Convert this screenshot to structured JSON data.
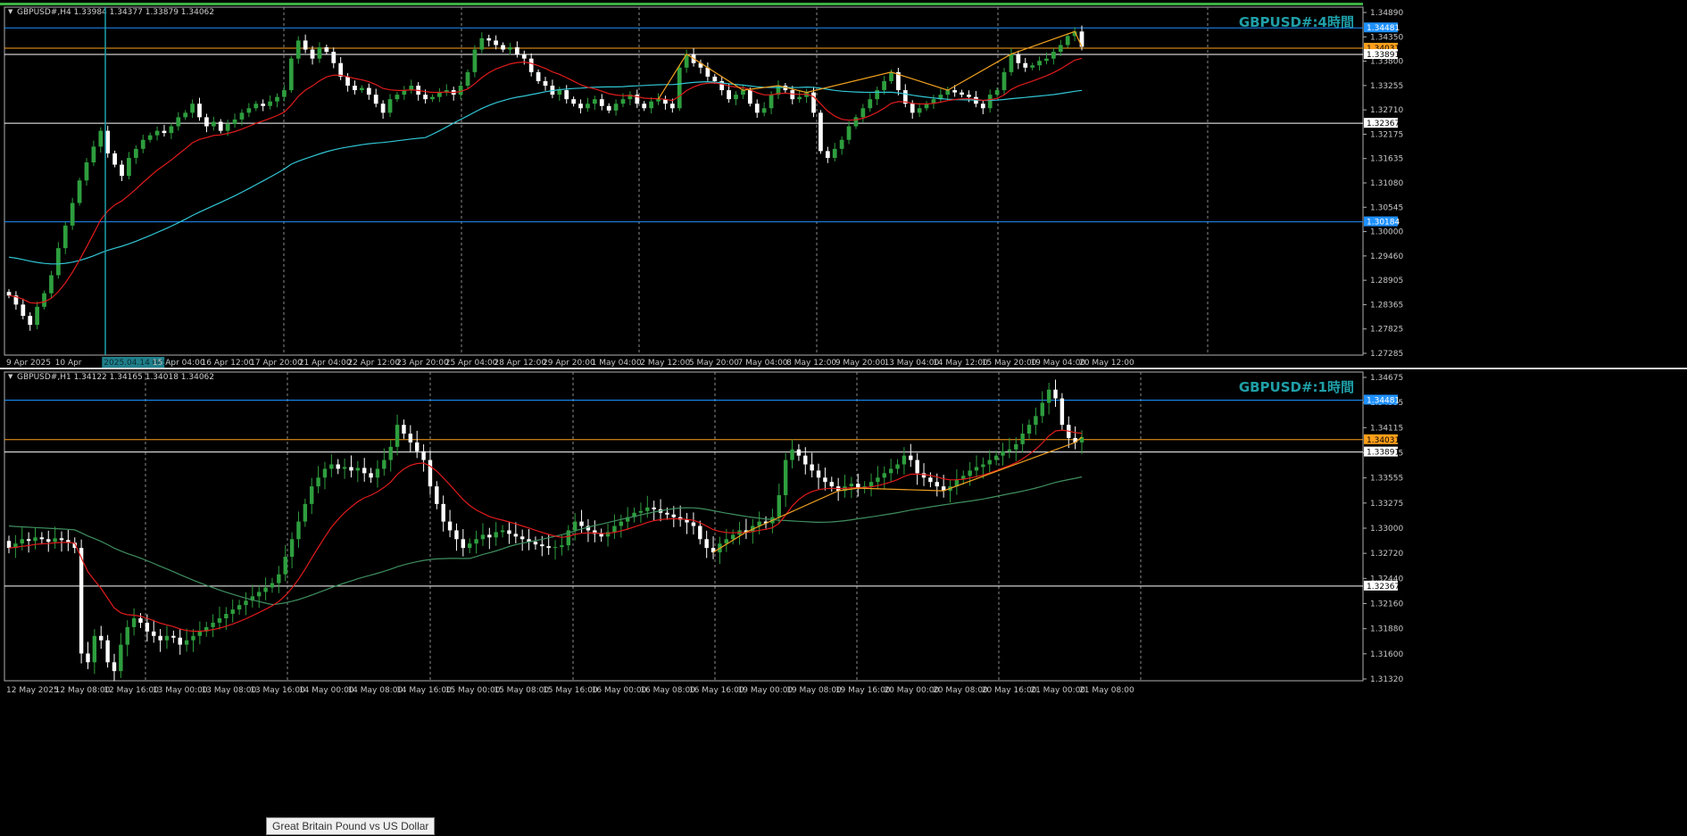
{
  "colors": {
    "background": "#000000",
    "bull": "#2e9e3e",
    "bear": "#ffffff",
    "ma_fast": "#e01b1b",
    "ma_slow_h4": "#31c6d4",
    "ma_slow_h1": "#3f8f5f",
    "zigzag": "#f0a020",
    "line_blue": "#1e90ff",
    "line_orange": "#ff9f1a",
    "line_white": "#ffffff",
    "title": "#1f9fa8",
    "axis_text": "#c8c8c8",
    "grid": "#8a8a8a",
    "frame_top": "#3cb043"
  },
  "tooltip": "Great Britain Pound vs US Dollar",
  "chart_data": [
    {
      "type": "candlestick",
      "symbol_info": "GBPUSD#,H4  1.33984 1.34377 1.33879 1.34062",
      "title": "GBPUSD#:4時間",
      "y_ticks": [
        "1.34890",
        "1.34350",
        "1.33800",
        "1.33255",
        "1.32710",
        "1.32175",
        "1.31635",
        "1.31080",
        "1.30545",
        "1.30000",
        "1.29460",
        "1.28905",
        "1.28365",
        "1.27825",
        "1.27285"
      ],
      "x_ticks": [
        "9 Apr 2025",
        "10 Apr",
        "2025.04.14 08:00",
        "15 Apr 04:00",
        "16 Apr 12:00",
        "17 Apr 20:00",
        "21 Apr 04:00",
        "22 Apr 12:00",
        "23 Apr 20:00",
        "25 Apr 04:00",
        "28 Apr 12:00",
        "29 Apr 20:00",
        "1 May 04:00",
        "2 May 12:00",
        "5 May 20:00",
        "7 May 04:00",
        "8 May 12:00",
        "9 May 20:00",
        "13 May 04:00",
        "14 May 12:00",
        "15 May 20:00",
        "19 May 04:00",
        "20 May 12:00"
      ],
      "ylim": [
        1.2723,
        1.3494
      ],
      "levels": [
        {
          "value": 1.34481,
          "label": "1.34481",
          "kind": "blue"
        },
        {
          "value": 1.34031,
          "label": "1.34031",
          "kind": "orange"
        },
        {
          "value": 1.33891,
          "label": "1.33891",
          "kind": "white"
        },
        {
          "value": 1.32367,
          "label": "1.32367",
          "kind": "white"
        },
        {
          "value": 1.30184,
          "label": "1.30184",
          "kind": "blue"
        }
      ],
      "closes": [
        1.2855,
        1.2835,
        1.281,
        1.279,
        1.283,
        1.286,
        1.29,
        1.296,
        1.301,
        1.306,
        1.311,
        1.315,
        1.3185,
        1.322,
        1.317,
        1.3145,
        1.312,
        1.316,
        1.318,
        1.32,
        1.321,
        1.322,
        1.3215,
        1.323,
        1.325,
        1.326,
        1.328,
        1.325,
        1.323,
        1.324,
        1.322,
        1.3235,
        1.3245,
        1.326,
        1.327,
        1.328,
        1.3275,
        1.3285,
        1.3295,
        1.331,
        1.338,
        1.342,
        1.34,
        1.338,
        1.3405,
        1.3395,
        1.337,
        1.334,
        1.332,
        1.331,
        1.3315,
        1.33,
        1.328,
        1.326,
        1.329,
        1.33,
        1.331,
        1.332,
        1.33,
        1.329,
        1.3295,
        1.3305,
        1.331,
        1.33,
        1.332,
        1.335,
        1.34,
        1.3425,
        1.342,
        1.341,
        1.34,
        1.3405,
        1.339,
        1.338,
        1.335,
        1.333,
        1.332,
        1.33,
        1.331,
        1.329,
        1.328,
        1.327,
        1.328,
        1.329,
        1.3275,
        1.3265,
        1.328,
        1.329,
        1.33,
        1.328,
        1.327,
        1.3285,
        1.329,
        1.328,
        1.327,
        1.336,
        1.339,
        1.337,
        1.336,
        1.334,
        1.333,
        1.331,
        1.329,
        1.33,
        1.331,
        1.328,
        1.326,
        1.327,
        1.33,
        1.332,
        1.331,
        1.329,
        1.3295,
        1.3305,
        1.326,
        1.3175,
        1.316,
        1.318,
        1.32,
        1.323,
        1.325,
        1.327,
        1.329,
        1.331,
        1.333,
        1.335,
        1.331,
        1.328,
        1.326,
        1.327,
        1.328,
        1.329,
        1.33,
        1.331,
        1.3305,
        1.33,
        1.3295,
        1.328,
        1.327,
        1.33,
        1.331,
        1.335,
        1.339,
        1.337,
        1.336,
        1.3365,
        1.3375,
        1.338,
        1.3395,
        1.341,
        1.343,
        1.344,
        1.3406
      ]
    },
    {
      "type": "candlestick",
      "symbol_info": "GBPUSD#,H1  1.34122 1.34165 1.34018 1.34062",
      "title": "GBPUSD#:1時間",
      "y_ticks": [
        "1.34675",
        "1.34395",
        "1.34115",
        "1.33835",
        "1.33555",
        "1.33275",
        "1.33000",
        "1.32720",
        "1.32440",
        "1.32160",
        "1.31880",
        "1.31600",
        "1.31320"
      ],
      "x_ticks": [
        "12 May 2025",
        "12 May 08:00",
        "12 May 16:00",
        "13 May 00:00",
        "13 May 08:00",
        "13 May 16:00",
        "14 May 00:00",
        "14 May 08:00",
        "14 May 16:00",
        "15 May 00:00",
        "15 May 08:00",
        "15 May 16:00",
        "16 May 00:00",
        "16 May 08:00",
        "16 May 16:00",
        "19 May 00:00",
        "19 May 08:00",
        "19 May 16:00",
        "20 May 00:00",
        "20 May 08:00",
        "20 May 16:00",
        "21 May 00:00",
        "21 May 08:00"
      ],
      "ylim": [
        1.3129,
        1.348
      ],
      "levels": [
        {
          "value": 1.34481,
          "label": "1.34481",
          "kind": "blue"
        },
        {
          "value": 1.34031,
          "label": "1.34031",
          "kind": "orange"
        },
        {
          "value": 1.33891,
          "label": "1.33891",
          "kind": "white"
        },
        {
          "value": 1.32367,
          "label": "1.32367",
          "kind": "white"
        }
      ],
      "closes": [
        1.328,
        1.3285,
        1.329,
        1.3288,
        1.3292,
        1.329,
        1.3287,
        1.3291,
        1.3289,
        1.3286,
        1.328,
        1.316,
        1.315,
        1.318,
        1.3175,
        1.315,
        1.314,
        1.317,
        1.319,
        1.32,
        1.3195,
        1.3185,
        1.318,
        1.3175,
        1.318,
        1.3178,
        1.317,
        1.3175,
        1.318,
        1.3185,
        1.319,
        1.3195,
        1.32,
        1.3205,
        1.321,
        1.3215,
        1.322,
        1.3225,
        1.323,
        1.3235,
        1.324,
        1.325,
        1.327,
        1.329,
        1.331,
        1.333,
        1.335,
        1.336,
        1.337,
        1.3375,
        1.337,
        1.3372,
        1.3368,
        1.3371,
        1.3365,
        1.336,
        1.337,
        1.338,
        1.3395,
        1.342,
        1.341,
        1.34,
        1.339,
        1.338,
        1.335,
        1.333,
        1.331,
        1.33,
        1.329,
        1.328,
        1.3285,
        1.329,
        1.3295,
        1.3292,
        1.3298,
        1.33,
        1.3296,
        1.3293,
        1.329,
        1.3287,
        1.3284,
        1.3282,
        1.328,
        1.3281,
        1.3283,
        1.33,
        1.331,
        1.3305,
        1.33,
        1.3296,
        1.3293,
        1.3298,
        1.3305,
        1.331,
        1.3315,
        1.332,
        1.3322,
        1.3326,
        1.3324,
        1.332,
        1.3318,
        1.3315,
        1.3312,
        1.3309,
        1.3305,
        1.329,
        1.328,
        1.3275,
        1.3285,
        1.329,
        1.3295,
        1.33,
        1.3298,
        1.3305,
        1.331,
        1.3308,
        1.3315,
        1.334,
        1.338,
        1.3392,
        1.3385,
        1.3375,
        1.3368,
        1.336,
        1.3355,
        1.335,
        1.3345,
        1.335,
        1.3353,
        1.3348,
        1.335,
        1.3355,
        1.336,
        1.3365,
        1.337,
        1.3375,
        1.3385,
        1.338,
        1.3365,
        1.336,
        1.3355,
        1.335,
        1.3345,
        1.335,
        1.3358,
        1.3362,
        1.3368,
        1.3372,
        1.3375,
        1.338,
        1.3385,
        1.339,
        1.3392,
        1.3398,
        1.341,
        1.342,
        1.343,
        1.3445,
        1.346,
        1.345,
        1.342,
        1.3405,
        1.34,
        1.3406
      ]
    }
  ]
}
